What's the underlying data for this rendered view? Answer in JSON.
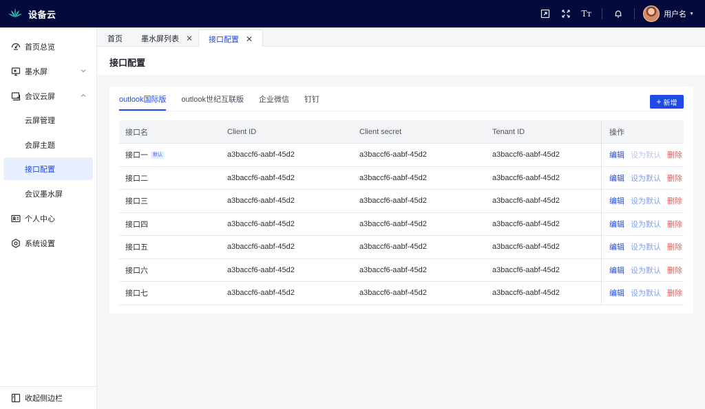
{
  "app": {
    "title": "设备云"
  },
  "header": {
    "icons": [
      "screen-share-icon",
      "fullscreen-icon",
      "font-size-icon",
      "bell-icon"
    ],
    "font_icon_text": "Tт",
    "user_name": "用户名"
  },
  "sidebar": {
    "items": [
      {
        "label": "首页总览",
        "icon": "dashboard-icon"
      },
      {
        "label": "墨水屏",
        "icon": "ink-screen-icon",
        "chevron": "down"
      },
      {
        "label": "会议云屏",
        "icon": "meeting-screen-icon",
        "chevron": "up"
      },
      {
        "label": "云屏管理"
      },
      {
        "label": "会屏主题"
      },
      {
        "label": "接口配置",
        "active": true
      },
      {
        "label": "会议墨水屏"
      },
      {
        "label": "个人中心",
        "icon": "id-card-icon"
      },
      {
        "label": "系统设置",
        "icon": "gear-icon"
      }
    ],
    "collapse_label": "收起侧边栏"
  },
  "page_tabs": [
    {
      "label": "首页"
    },
    {
      "label": "墨水屏列表",
      "closable": true
    },
    {
      "label": "接口配置",
      "closable": true,
      "active": true
    }
  ],
  "page": {
    "title": "接口配置"
  },
  "sub_tabs": [
    {
      "label": "outlook国际版",
      "active": true
    },
    {
      "label": "outlook世纪互联版"
    },
    {
      "label": "企业微信"
    },
    {
      "label": "钉钉"
    }
  ],
  "add_button": {
    "plus": "+",
    "label": "新增"
  },
  "table": {
    "columns": [
      "接口名",
      "Client ID",
      "Client secret",
      "Tenant ID",
      "操作"
    ],
    "rows": [
      {
        "name": "接口一",
        "badge": "默认",
        "client_id": "a3baccf6-aabf-45d2",
        "client_secret": "a3baccf6-aabf-45d2",
        "tenant_id": "a3baccf6-aabf-45d2",
        "is_default": true
      },
      {
        "name": "接口二",
        "client_id": "a3baccf6-aabf-45d2",
        "client_secret": "a3baccf6-aabf-45d2",
        "tenant_id": "a3baccf6-aabf-45d2"
      },
      {
        "name": "接口三",
        "client_id": "a3baccf6-aabf-45d2",
        "client_secret": "a3baccf6-aabf-45d2",
        "tenant_id": "a3baccf6-aabf-45d2"
      },
      {
        "name": "接口四",
        "client_id": "a3baccf6-aabf-45d2",
        "client_secret": "a3baccf6-aabf-45d2",
        "tenant_id": "a3baccf6-aabf-45d2"
      },
      {
        "name": "接口五",
        "client_id": "a3baccf6-aabf-45d2",
        "client_secret": "a3baccf6-aabf-45d2",
        "tenant_id": "a3baccf6-aabf-45d2"
      },
      {
        "name": "接口六",
        "client_id": "a3baccf6-aabf-45d2",
        "client_secret": "a3baccf6-aabf-45d2",
        "tenant_id": "a3baccf6-aabf-45d2"
      },
      {
        "name": "接口七",
        "client_id": "a3baccf6-aabf-45d2",
        "client_secret": "a3baccf6-aabf-45d2",
        "tenant_id": "a3baccf6-aabf-45d2"
      }
    ],
    "actions": {
      "edit": "编辑",
      "set_default": "设为默认",
      "delete": "删除"
    }
  },
  "colors": {
    "topbar": "#050a3c",
    "accent": "#1f4ae6",
    "active_menu_bg": "#e8efff",
    "delete": "#ef5656",
    "logo": "#2fc4b2"
  }
}
